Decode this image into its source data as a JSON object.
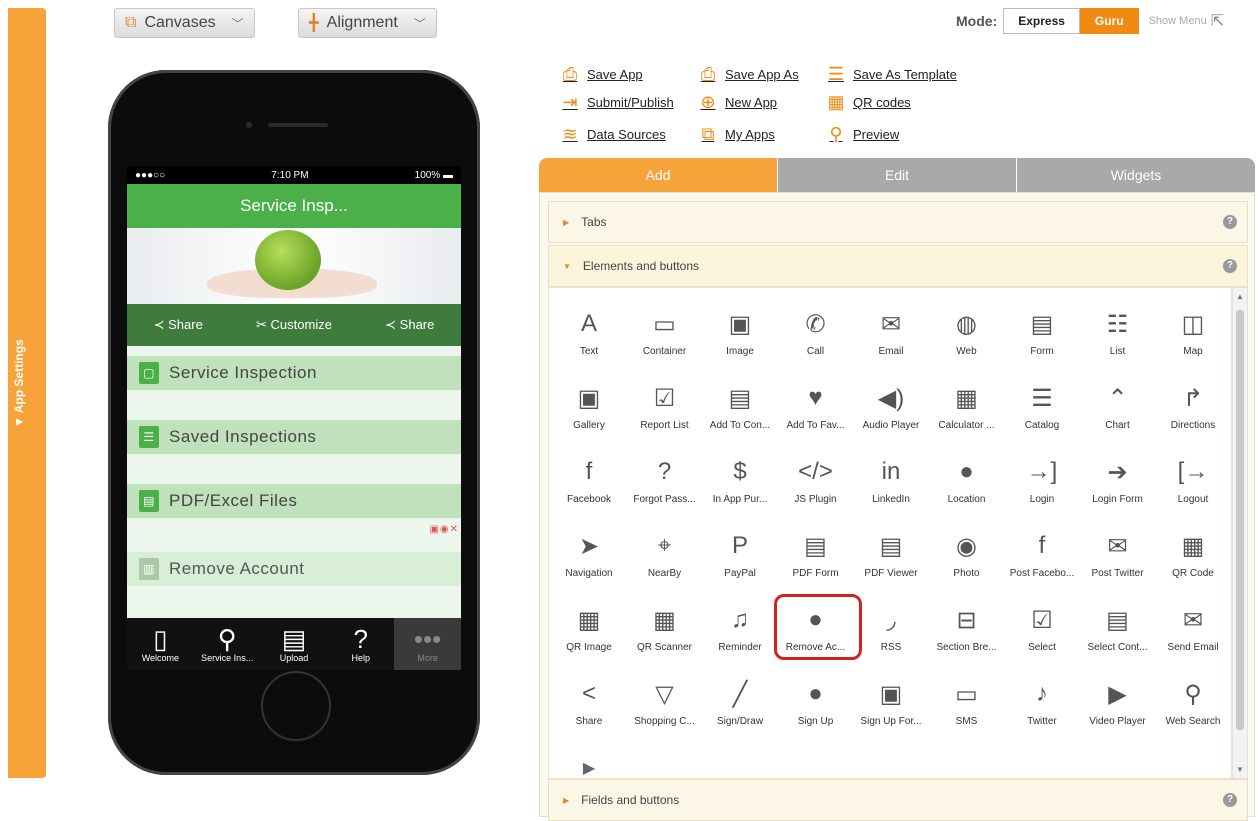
{
  "left_sidebar": {
    "label": "▼ App Settings"
  },
  "top_buttons": {
    "canvases": "Canvases",
    "alignment": "Alignment"
  },
  "mode": {
    "label": "Mode:",
    "express": "Express",
    "guru": "Guru",
    "show_menu": "Show Menu"
  },
  "phone": {
    "status": {
      "carrier": "●●●○○",
      "time": "7:10 PM",
      "battery": "100%"
    },
    "app_title": "Service Insp...",
    "actions": [
      "Share",
      "Customize",
      "Share"
    ],
    "menu_items": [
      "Service Inspection",
      "Saved Inspections",
      "PDF/Excel Files",
      "Remove Account"
    ],
    "tabs": [
      "Welcome",
      "Service Ins...",
      "Upload",
      "Help",
      "More"
    ]
  },
  "links": [
    {
      "label": "Save App",
      "icon": "save-icon"
    },
    {
      "label": "Save App As",
      "icon": "save-as-icon"
    },
    {
      "label": "Save As Template",
      "icon": "template-icon"
    },
    {
      "label": "Submit/Publish",
      "icon": "submit-icon"
    },
    {
      "label": "New App",
      "icon": "plus-icon"
    },
    {
      "label": "QR codes",
      "icon": "qr-icon"
    },
    {
      "label": "Data Sources",
      "icon": "database-icon"
    },
    {
      "label": "My Apps",
      "icon": "apps-icon"
    },
    {
      "label": "Preview",
      "icon": "magnifier-icon"
    }
  ],
  "panel_tabs": [
    "Add",
    "Edit",
    "Widgets"
  ],
  "accordions": {
    "tabs": "Tabs",
    "elements": "Elements and buttons",
    "fields": "Fields and buttons"
  },
  "elements": [
    "Text",
    "Container",
    "Image",
    "Call",
    "Email",
    "Web",
    "Form",
    "List",
    "Map",
    "Gallery",
    "Report List",
    "Add To Con...",
    "Add To Fav...",
    "Audio Player",
    "Calculator ...",
    "Catalog",
    "Chart",
    "Directions",
    "Facebook",
    "Forgot Pass...",
    "In App Pur...",
    "JS Plugin",
    "LinkedIn",
    "Location",
    "Login",
    "Login Form",
    "Logout",
    "Navigation",
    "NearBy",
    "PayPal",
    "PDF Form",
    "PDF Viewer",
    "Photo",
    "Post Facebo...",
    "Post Twitter",
    "QR Code",
    "QR Image",
    "QR Scanner",
    "Reminder",
    "Remove Ac...",
    "RSS",
    "Section Bre...",
    "Select",
    "Select Cont...",
    "Send Email",
    "Share",
    "Shopping C...",
    "Sign/Draw",
    "Sign Up",
    "Sign Up For...",
    "SMS",
    "Twitter",
    "Video Player",
    "Web Search"
  ],
  "element_glyphs": [
    "A",
    "▭",
    "▣",
    "✆",
    "✉",
    "◍",
    "▤",
    "☷",
    "◫",
    "▣",
    "☑",
    "▤",
    "♥",
    "◀)",
    "▦",
    "☰",
    "⌃",
    "↱",
    "f",
    "?",
    "$",
    "</>",
    "in",
    "●",
    "→]",
    "➔",
    "[→",
    "➤",
    "⌖",
    "P",
    "▤",
    "▤",
    "◉",
    "f",
    "✉",
    "▦",
    "▦",
    "▦",
    "♫",
    "●",
    "◞",
    "⊟",
    "☑",
    "▤",
    "✉",
    "<",
    "▽",
    "╱",
    "●",
    "▣",
    "▭",
    "♪",
    "▶",
    "⚲"
  ],
  "highlighted_element": "Remove Ac..."
}
